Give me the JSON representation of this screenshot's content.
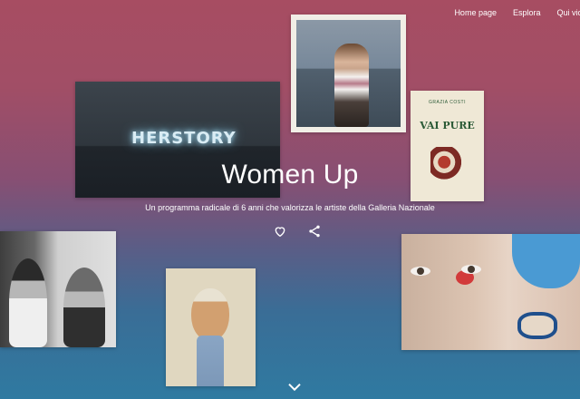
{
  "nav": {
    "items": [
      "Home page",
      "Esplora",
      "Qui vici"
    ]
  },
  "hero": {
    "title": "Women Up",
    "subtitle": "Un programma radicale di 6 anni che valorizza le artiste della Galleria Nazionale"
  },
  "artworks": {
    "neon_text": "HERSTORY",
    "book_author": "GRAZIA COSTI",
    "book_title": "VAI PURE"
  },
  "icons": [
    "heart-icon",
    "share-icon",
    "chevron-down-icon"
  ],
  "colors": {
    "top": "#a74d62",
    "bottom": "#2f7aa1"
  }
}
